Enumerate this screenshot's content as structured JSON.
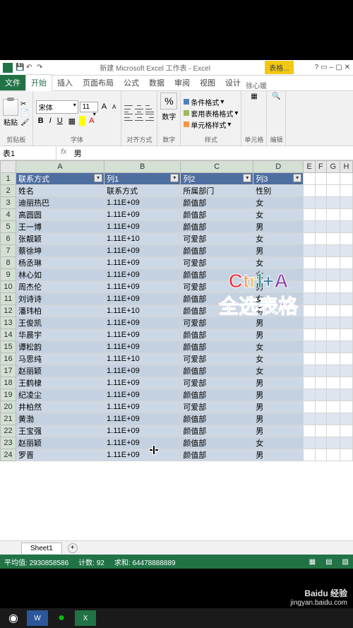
{
  "title": "新建 Microsoft Excel 工作表 - Excel",
  "contextTab": "表格...",
  "user": "徐心媛",
  "tabs": {
    "file": "文件",
    "home": "开始",
    "insert": "插入",
    "layout": "页面布局",
    "formulas": "公式",
    "data": "数据",
    "review": "审阅",
    "view": "视图",
    "design": "设计"
  },
  "ribbon": {
    "clipboard": {
      "paste": "粘贴",
      "label": "剪贴板"
    },
    "font": {
      "name": "宋体",
      "size": "11",
      "label": "字体"
    },
    "align": {
      "label": "对齐方式"
    },
    "number": {
      "btn": "数字",
      "label": "数字",
      "pct": "%"
    },
    "styles": {
      "cond": "条件格式",
      "tablefmt": "套用表格格式",
      "cellfmt": "单元格样式",
      "label": "样式"
    },
    "cells": {
      "label": "单元格"
    },
    "editing": {
      "label": "编辑"
    }
  },
  "namebox": "表1",
  "formula_fx": "fx",
  "formula_val": "男",
  "colHeaders": [
    "A",
    "B",
    "C",
    "D",
    "E",
    "F",
    "G",
    "H"
  ],
  "tableHeaders": [
    "联系方式",
    "列1",
    "列2",
    "列3"
  ],
  "rows": [
    [
      "姓名",
      "联系方式",
      "所属部门",
      "性别"
    ],
    [
      "迪丽热巴",
      "1.11E+09",
      "颜值部",
      "女"
    ],
    [
      "高圆圆",
      "1.11E+09",
      "颜值部",
      "女"
    ],
    [
      "王一博",
      "1.11E+09",
      "颜值部",
      "男"
    ],
    [
      "张靓颖",
      "1.11E+10",
      "可爱部",
      "女"
    ],
    [
      "蔡徐坤",
      "1.11E+09",
      "颜值部",
      "男"
    ],
    [
      "杨丞琳",
      "1.11E+09",
      "可爱部",
      "女"
    ],
    [
      "林心如",
      "1.11E+09",
      "颜值部",
      "女"
    ],
    [
      "周杰伦",
      "1.11E+09",
      "可爱部",
      "男"
    ],
    [
      "刘诗诗",
      "1.11E+09",
      "颜值部",
      "女"
    ],
    [
      "潘玮柏",
      "1.11E+10",
      "颜值部",
      "男"
    ],
    [
      "王俊凯",
      "1.11E+09",
      "可爱部",
      "男"
    ],
    [
      "华晨宇",
      "1.11E+09",
      "颜值部",
      "男"
    ],
    [
      "谭松韵",
      "1.11E+09",
      "颜值部",
      "女"
    ],
    [
      "马思纯",
      "1.11E+10",
      "可爱部",
      "女"
    ],
    [
      "赵丽颖",
      "1.11E+09",
      "颜值部",
      "女"
    ],
    [
      "王鹤棣",
      "1.11E+09",
      "可爱部",
      "男"
    ],
    [
      "纪凌尘",
      "1.11E+09",
      "颜值部",
      "男"
    ],
    [
      "井柏然",
      "1.11E+09",
      "可爱部",
      "男"
    ],
    [
      "黄渤",
      "1.11E+09",
      "颜值部",
      "男"
    ],
    [
      "王宝强",
      "1.11E+09",
      "颜值部",
      "男"
    ],
    [
      "赵丽颖",
      "1.11E+09",
      "颜值部",
      "女"
    ],
    [
      "罗晋",
      "1.11E+09",
      "颜值部",
      "男"
    ]
  ],
  "sheet": {
    "name": "Sheet1"
  },
  "status": {
    "avg_lbl": "平均值:",
    "avg": "2930858586",
    "cnt_lbl": "计数:",
    "cnt": "92",
    "sum_lbl": "求和:",
    "sum": "64478888889"
  },
  "overlay": {
    "line1": "Ctrl+A",
    "line2": "全选表格"
  },
  "watermark": {
    "brand": "Baidu 经验",
    "url": "jingyan.baidu.com"
  }
}
